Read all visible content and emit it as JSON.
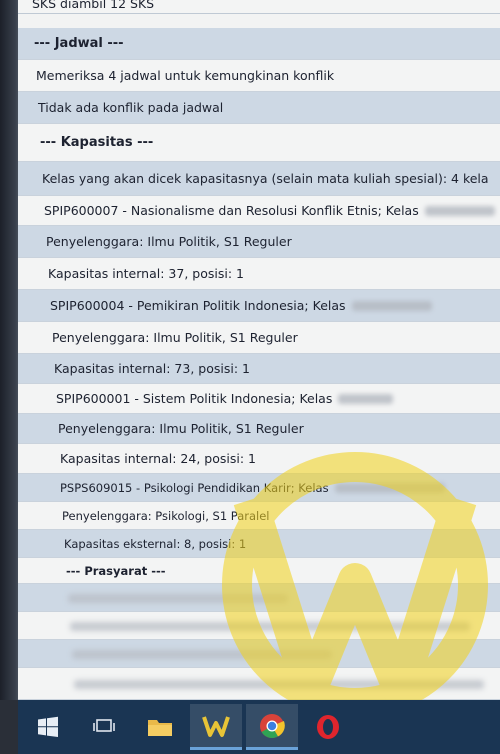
{
  "top_line": "SKS diambil 12 SKS",
  "rows": [
    {
      "text": "--- Jadwal ---"
    },
    {
      "text": "Memeriksa 4 jadwal untuk kemungkinan konflik"
    },
    {
      "text": "Tidak ada konflik pada jadwal"
    },
    {
      "text": "--- Kapasitas ---"
    },
    {
      "text": "Kelas yang akan dicek kapasitasnya (selain mata kuliah spesial): 4 kela"
    },
    {
      "text": "SPIP600007 - Nasionalisme dan Resolusi Konflik Etnis; Kelas"
    },
    {
      "text": "Penyelenggara: Ilmu Politik, S1 Reguler"
    },
    {
      "text": "Kapasitas internal: 37, posisi: 1"
    },
    {
      "text": "SPIP600004 - Pemikiran Politik Indonesia; Kelas"
    },
    {
      "text": "Penyelenggara: Ilmu Politik, S1 Reguler"
    },
    {
      "text": "Kapasitas internal: 73, posisi: 1"
    },
    {
      "text": "SPIP600001 - Sistem Politik Indonesia; Kelas"
    },
    {
      "text": "Penyelenggara: Ilmu Politik, S1 Reguler"
    },
    {
      "text": "Kapasitas internal: 24, posisi: 1"
    },
    {
      "text": "PSPS609015 - Psikologi Pendidikan Karir; Kelas"
    },
    {
      "text": "Penyelenggara: Psikologi, S1 Paralel"
    },
    {
      "text": "Kapasitas eksternal: 8, posisi: 1"
    },
    {
      "text": "--- Prasyarat ---"
    }
  ],
  "taskbar": {
    "items": [
      "windows-start",
      "task-view",
      "file-explorer",
      "w-app",
      "chrome",
      "opera"
    ]
  },
  "colors": {
    "row_shaded": "#cdd8e4",
    "row_plain": "#f3f4f4",
    "taskbar": "#1a3553",
    "watermark": "#f2d21a"
  }
}
